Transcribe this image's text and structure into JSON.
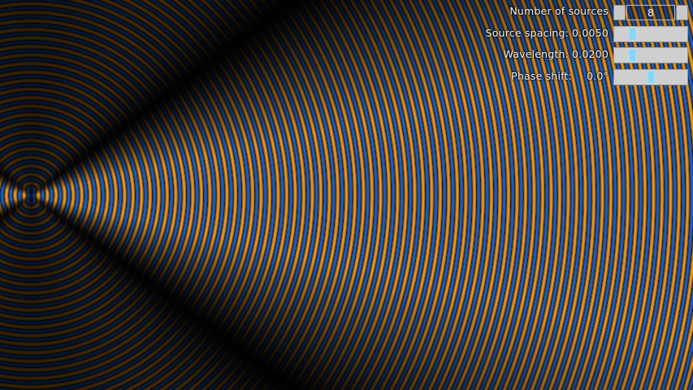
{
  "controls": {
    "num_sources": {
      "label": "Number of sources",
      "value": "8"
    },
    "spacing": {
      "label": "Source spacing:",
      "value": "0.0050",
      "level": 0.25
    },
    "wavelength": {
      "label": "Wavelength:",
      "value": "0.0200",
      "level": 0.25
    },
    "phase": {
      "label": "Phase shift:",
      "value": "0.0°",
      "level": 0.5
    }
  },
  "colors": {
    "wave_positive": "#f59a1f",
    "wave_negative": "#1f63c8",
    "slider_thumb": "#7fd8ff",
    "slider_track": "#cfcfcf"
  }
}
